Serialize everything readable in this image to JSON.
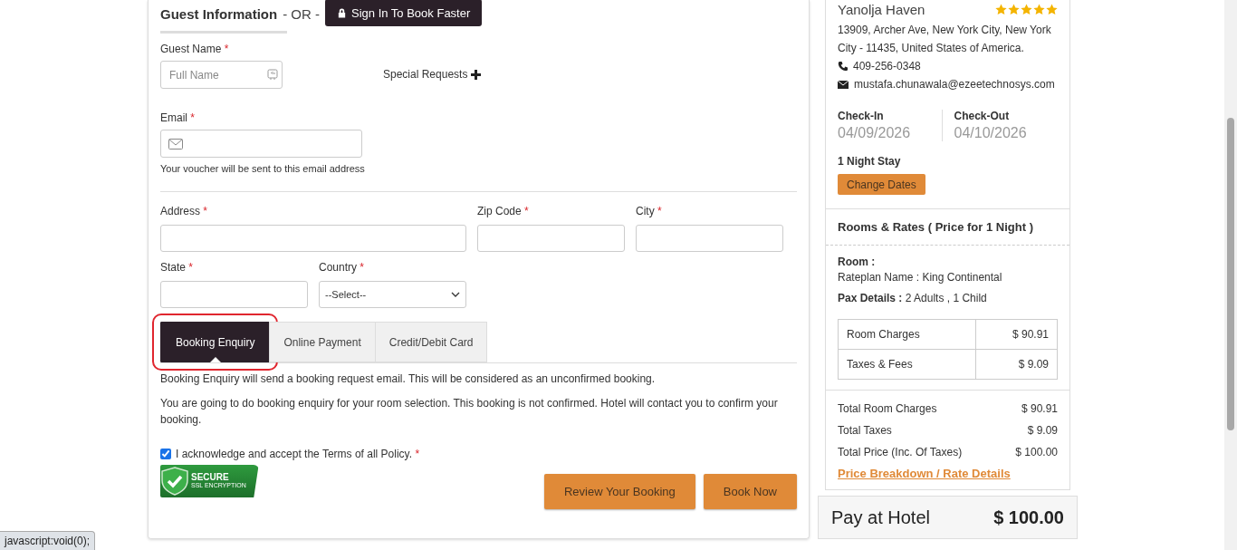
{
  "guest_info": {
    "title": "Guest Information",
    "or_text": "- OR -",
    "sign_in_button": "Sign In To Book Faster",
    "guest_name": {
      "label": "Guest Name",
      "required_mark": "*",
      "placeholder": "Full Name"
    },
    "special_requests": "Special Requests",
    "email": {
      "label": "Email",
      "required_mark": "*",
      "hint": "Your voucher will be sent to this email address"
    },
    "address_rows": [
      [
        {
          "label": "Address",
          "required_mark": "*",
          "kind": "wide_text"
        },
        {
          "label": "Zip Code",
          "required_mark": "*",
          "kind": "text"
        },
        {
          "label": "City",
          "required_mark": "*",
          "kind": "text"
        }
      ],
      [
        {
          "label": "State",
          "required_mark": "*",
          "kind": "text"
        },
        {
          "label": "Country",
          "required_mark": "*",
          "kind": "select",
          "value": "--Select--"
        }
      ]
    ],
    "payment_tabs": [
      {
        "label": "Booking Enquiry",
        "selected": true,
        "highlighted": true
      },
      {
        "label": "Online Payment",
        "selected": false,
        "highlighted": false
      },
      {
        "label": "Credit/Debit Card",
        "selected": false,
        "highlighted": false
      }
    ],
    "messages": [
      "Booking Enquiry will send a booking request email. This will be considered as an unconfirmed booking.",
      "You are going to do booking enquiry for your room selection. This booking is not confirmed. Hotel will contact you to confirm your booking."
    ],
    "terms": {
      "checked": true,
      "text": "I acknowledge and accept the Terms of all Policy.",
      "required_mark": "*"
    },
    "secure_badge": {
      "title": "SECURE",
      "subtitle": "SSL ENCRYPTION"
    },
    "buttons": [
      "Review Your Booking",
      "Book Now"
    ]
  },
  "summary": {
    "hotel_name": "Yanolja Haven",
    "stars": 5,
    "address": "13909, Archer Ave, New York City, New York City - 11435, United States of America.",
    "phone": "409-256-0348",
    "email": "mustafa.chunawala@ezeetechnosys.com",
    "check_in": {
      "label": "Check-In",
      "date": "04/09/2026"
    },
    "check_out": {
      "label": "Check-Out",
      "date": "04/10/2026"
    },
    "nights": "1 Night Stay",
    "change_dates_button": "Change Dates",
    "rooms_title": "Rooms & Rates ( Price for 1 Night )",
    "room_label": "Room :",
    "rateplan": "Rateplan Name : King Continental",
    "pax": "**Pax Details :** 2 Adults , 1 Child",
    "charges": [
      {
        "label": "Room Charges",
        "amount": "$ 90.91"
      },
      {
        "label": "Taxes & Fees",
        "amount": "$ 9.09"
      }
    ],
    "totals": [
      {
        "label": "Total Room Charges",
        "amount": "$ 90.91"
      },
      {
        "label": "Total Taxes",
        "amount": "$ 9.09"
      },
      {
        "label": "Total Price (Inc. Of Taxes)",
        "amount": "$ 100.00"
      }
    ],
    "breakdown_link": "Price Breakdown / Rate Details",
    "pay": {
      "label": "Pay at Hotel",
      "amount": "$ 100.00"
    }
  },
  "status_bar": "javascript:void(0);"
}
